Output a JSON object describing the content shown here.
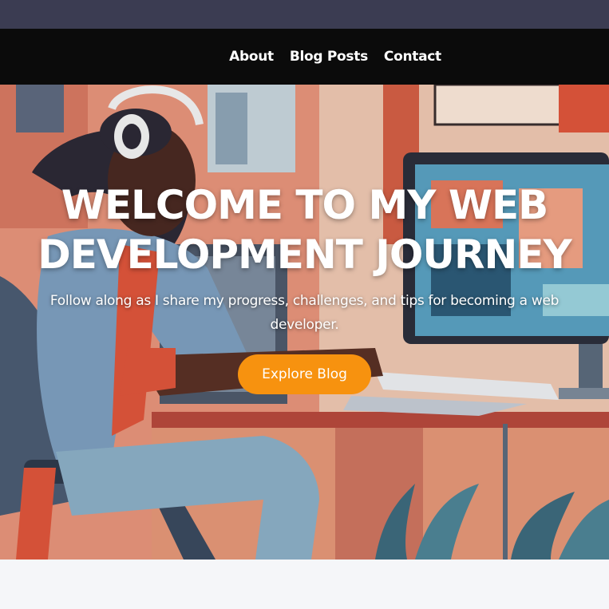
{
  "nav": {
    "links": [
      "About",
      "Blog Posts",
      "Contact"
    ]
  },
  "hero": {
    "title_line1": "WELCOME TO MY WEB",
    "title_line2": "DEVELOPMENT JOURNEY",
    "subtitle_line1": "Follow along as I share my progress, challenges, and tips for becoming a web",
    "subtitle_line2": "developer.",
    "cta_label": "Explore Blog",
    "image_description_icon": "developer-at-desk-illustration"
  },
  "colors": {
    "topbar": "#3b3c52",
    "navbar": "#0b0b0b",
    "accent": "#f7920f",
    "page_bg": "#f5f6f9"
  }
}
